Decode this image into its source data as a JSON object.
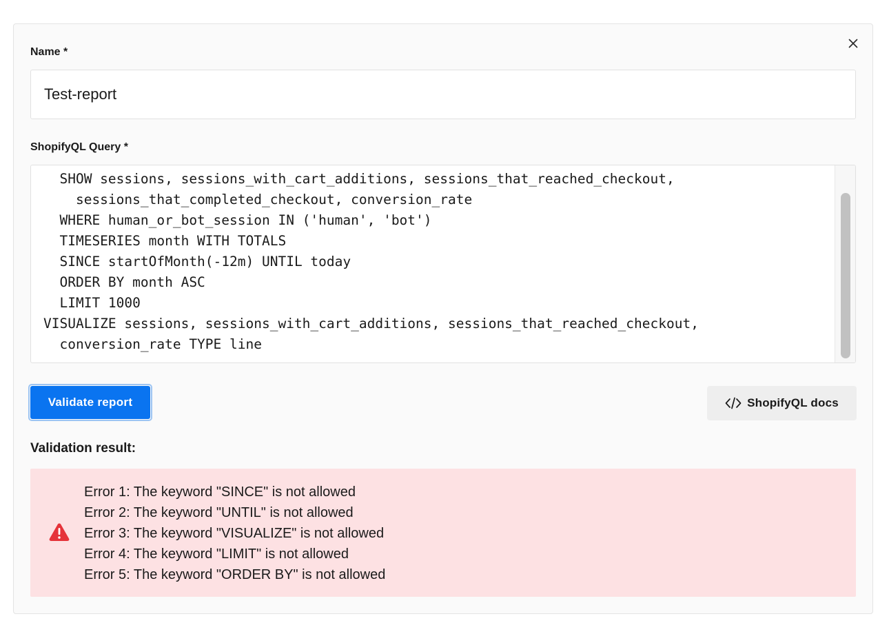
{
  "form": {
    "name_label": "Name *",
    "name_value": "Test-report",
    "query_label": "ShopifyQL Query *",
    "query_text": "  SHOW sessions, sessions_with_cart_additions, sessions_that_reached_checkout,\n    sessions_that_completed_checkout, conversion_rate\n  WHERE human_or_bot_session IN ('human', 'bot')\n  TIMESERIES month WITH TOTALS\n  SINCE startOfMonth(-12m) UNTIL today\n  ORDER BY month ASC\n  LIMIT 1000\nVISUALIZE sessions, sessions_with_cart_additions, sessions_that_reached_checkout,\n  conversion_rate TYPE line"
  },
  "actions": {
    "validate_label": "Validate report",
    "docs_label": "ShopifyQL docs",
    "docs_icon": "code-icon",
    "close_icon": "close-icon"
  },
  "validation": {
    "title": "Validation result:",
    "status_icon": "warning-icon",
    "errors": [
      "Error 1: The keyword \"SINCE\" is not allowed",
      "Error 2: The keyword \"UNTIL\" is not allowed",
      "Error 3: The keyword \"VISUALIZE\" is not allowed",
      "Error 4: The keyword \"LIMIT\" is not allowed",
      "Error 5: The keyword \"ORDER BY\" is not allowed"
    ]
  },
  "colors": {
    "primary": "#0a74f0",
    "error_bg": "#fde1e3",
    "error_icon": "#e5333a"
  }
}
